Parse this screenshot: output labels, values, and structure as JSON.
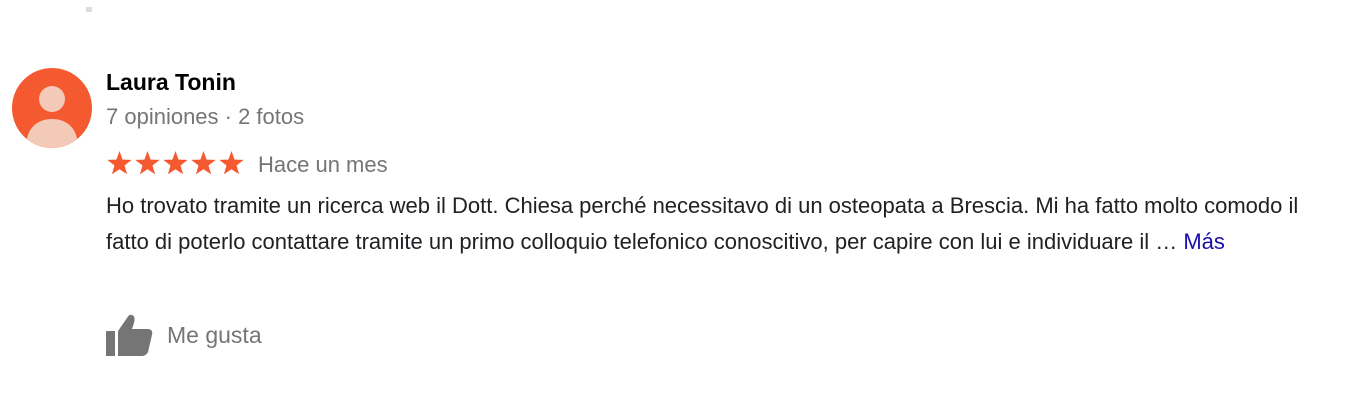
{
  "review": {
    "author": {
      "name": "Laura Tonin",
      "meta": "7 opiniones · 2 fotos",
      "avatar_icon": "person-avatar-icon",
      "avatar_color": "#f4592f"
    },
    "rating": {
      "stars": 5,
      "max_stars": 5,
      "star_color": "#f4592f",
      "star_icon": "star-icon"
    },
    "date": "Hace un mes",
    "text": "Ho trovato tramite un ricerca web il Dott. Chiesa perché necessitavo di un osteopata a Brescia. Mi ha fatto molto comodo il fatto di poterlo contattare tramite un primo colloquio telefonico conoscitivo, per capire con lui e individuare il …",
    "more_link": "Más",
    "more_link_color": "#1a0dab",
    "like": {
      "label": "Me gusta",
      "icon": "thumbs-up-icon"
    }
  }
}
